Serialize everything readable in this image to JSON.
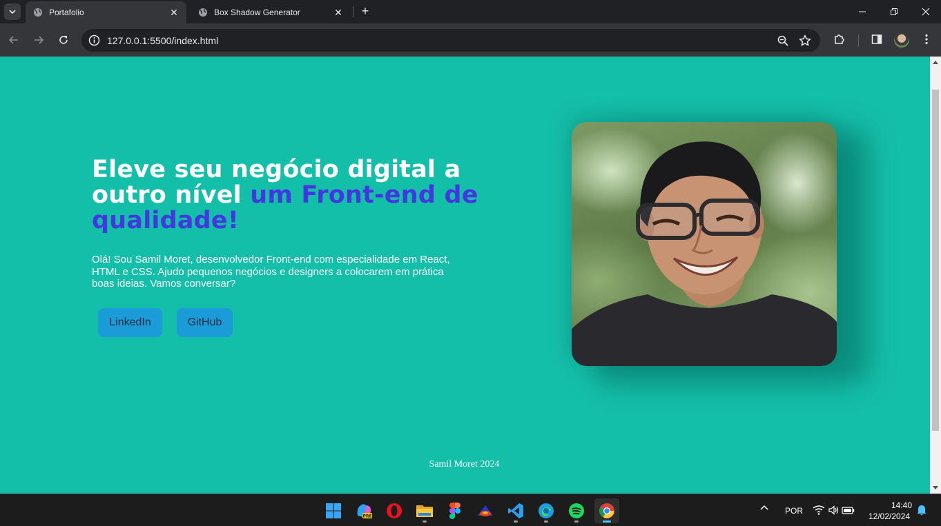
{
  "browser": {
    "tabs": [
      {
        "title": "Portafolio",
        "active": true
      },
      {
        "title": "Box Shadow Generator",
        "active": false
      }
    ],
    "url": "127.0.0.1:5500/index.html"
  },
  "page": {
    "headline_white": "Eleve seu negócio digital a outro nível",
    "headline_accent": "um Front-end de qualidade!",
    "intro": "Olá! Sou Samil Moret, desenvolvedor Front-end com especialidade em React, HTML e CSS. Ajudo pequenos negócios e designers a colocarem em prática boas ideias. Vamos conversar?",
    "buttons": {
      "linkedin": "LinkedIn",
      "github": "GitHub"
    },
    "footer": "Samil Moret 2024",
    "colors": {
      "background": "#14bfa9",
      "accent": "#4338e0",
      "button": "#1b9bd8"
    }
  },
  "taskbar": {
    "apps": [
      "start-icon",
      "copilot-pre-icon",
      "opera-icon",
      "file-explorer-icon",
      "figma-icon",
      "app-icon",
      "vscode-icon",
      "edge-icon",
      "spotify-icon",
      "chrome-icon"
    ],
    "language": "POR",
    "time": "14:40",
    "date": "12/02/2024"
  }
}
